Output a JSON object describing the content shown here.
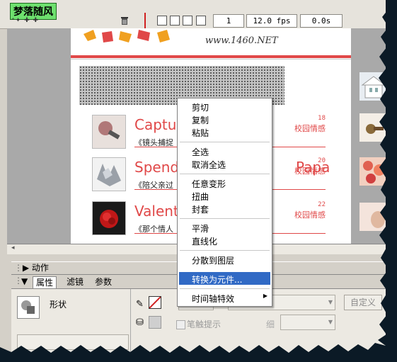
{
  "toolbar": {
    "brand": "梦落随风",
    "layer_icons": "⁺✦ ✚ ✚",
    "frame": "1",
    "fps": "12.0 fps",
    "time": "0.0s"
  },
  "stage": {
    "url": "www.1460.NET",
    "entries": [
      {
        "title": "Capture",
        "subtitle": "《镜头捕捉",
        "num": "18",
        "category": "校园情感"
      },
      {
        "title": "Spend th",
        "title_tail": "Papa",
        "subtitle": "《陪父亲过",
        "num": "20",
        "category": "校园情感"
      },
      {
        "title": "Valentin",
        "subtitle": "《那个情人",
        "num": "22",
        "category": "校园情感"
      }
    ]
  },
  "context_menu": {
    "items": [
      "剪切",
      "复制",
      "粘贴",
      "全选",
      "取消全选",
      "任意变形",
      "扭曲",
      "封套",
      "平滑",
      "直线化",
      "分散到图层",
      "转换为元件...",
      "时间轴特效"
    ],
    "highlighted": "转换为元件...",
    "highlight_color": "#316ac5"
  },
  "panels": {
    "actions_title": "动作",
    "tabs": [
      "属性",
      "滤镜",
      "参数"
    ],
    "active_tab": "属性",
    "shape_label": "形状",
    "hint_label": "笔触提示",
    "gray_label": "细",
    "custom_button": "自定义"
  },
  "colors": {
    "accent_red": "#e04848",
    "brand_green": "#6ee06e"
  }
}
